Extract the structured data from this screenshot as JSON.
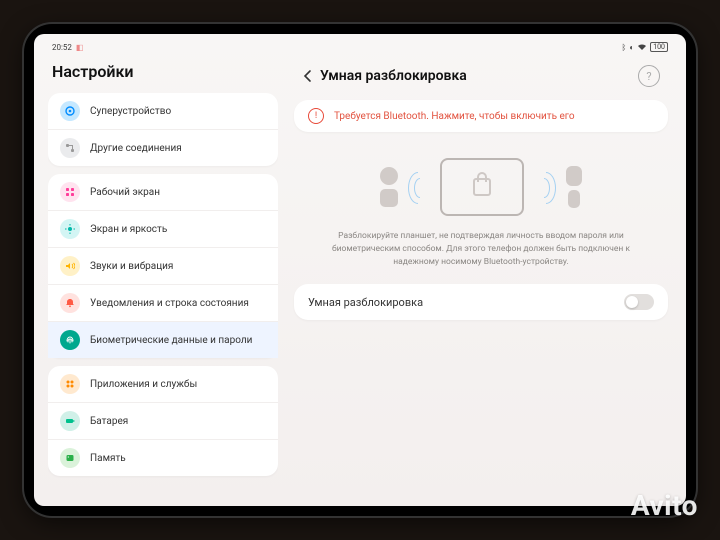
{
  "statusbar": {
    "time": "20:52",
    "battery": "100"
  },
  "sidebar": {
    "title": "Настройки",
    "items": [
      {
        "label": "Суперустройство",
        "icon": "superdevice",
        "cls": "ic-blue"
      },
      {
        "label": "Другие соединения",
        "icon": "connections",
        "cls": "ic-gray"
      },
      {
        "label": "Рабочий экран",
        "icon": "homescreen",
        "cls": "ic-pink"
      },
      {
        "label": "Экран и яркость",
        "icon": "brightness",
        "cls": "ic-cyan"
      },
      {
        "label": "Звуки и вибрация",
        "icon": "sound",
        "cls": "ic-yellow"
      },
      {
        "label": "Уведомления и строка состояния",
        "icon": "notifications",
        "cls": "ic-red"
      },
      {
        "label": "Биометрические данные и пароли",
        "icon": "biometrics",
        "cls": "ic-teal2"
      },
      {
        "label": "Приложения и службы",
        "icon": "apps",
        "cls": "ic-orange"
      },
      {
        "label": "Батарея",
        "icon": "battery",
        "cls": "ic-teal"
      },
      {
        "label": "Память",
        "icon": "storage",
        "cls": "ic-green"
      }
    ]
  },
  "main": {
    "title": "Умная разблокировка",
    "banner": "Требуется Bluetooth. Нажмите, чтобы включить его",
    "description": "Разблокируйте планшет, не подтверждая личность вводом пароля или биометрическим способом. Для этого телефон должен быть подключен к надежному носимому Bluetooth-устройству.",
    "row_label": "Умная разблокировка"
  },
  "watermark": "Avito"
}
